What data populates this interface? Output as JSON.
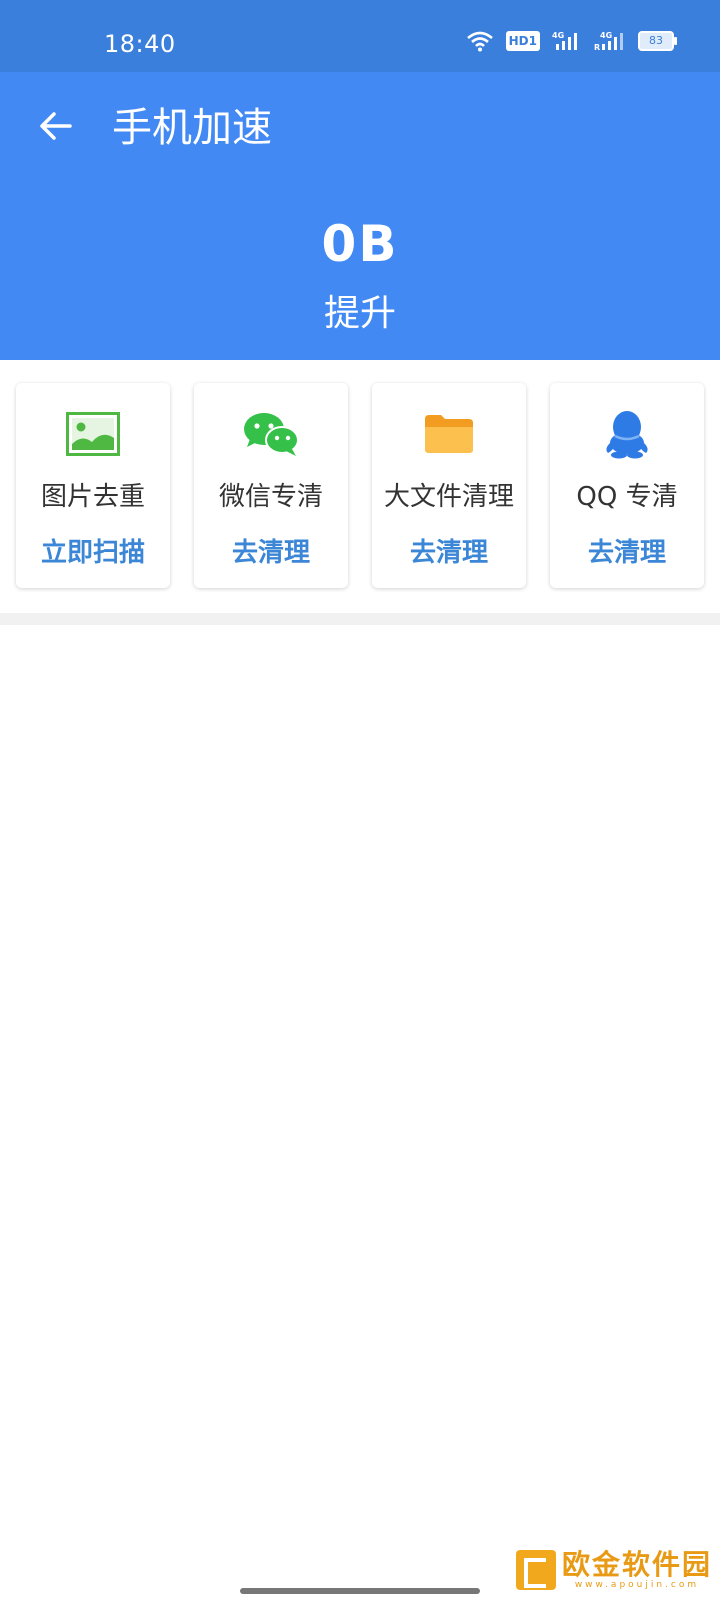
{
  "status_bar": {
    "time": "18:40",
    "hd_label": "HD1",
    "battery": "83",
    "icons": [
      "wifi-icon",
      "hd-icon",
      "signal-4g-icon",
      "signal-4g-roaming-icon",
      "battery-icon"
    ]
  },
  "header": {
    "title": "手机加速",
    "size_value": "0B",
    "subtitle": "提升"
  },
  "cards": [
    {
      "name": "图片去重",
      "action": "立即扫描",
      "icon": "image-icon"
    },
    {
      "name": "微信专清",
      "action": "去清理",
      "icon": "wechat-icon"
    },
    {
      "name": "大文件清理",
      "action": "去清理",
      "icon": "folder-icon"
    },
    {
      "name": "QQ 专清",
      "action": "去清理",
      "icon": "qq-icon"
    }
  ],
  "watermark": {
    "cn": "欧金软件园",
    "en": "www.apoujin.com"
  },
  "colors": {
    "status_bar": "#3b7fdc",
    "header": "#4289f4",
    "action_text": "#3b86d6",
    "wechat_green": "#35c04a",
    "folder_orange": "#f7b03a",
    "qq_blue": "#2f7be6"
  }
}
